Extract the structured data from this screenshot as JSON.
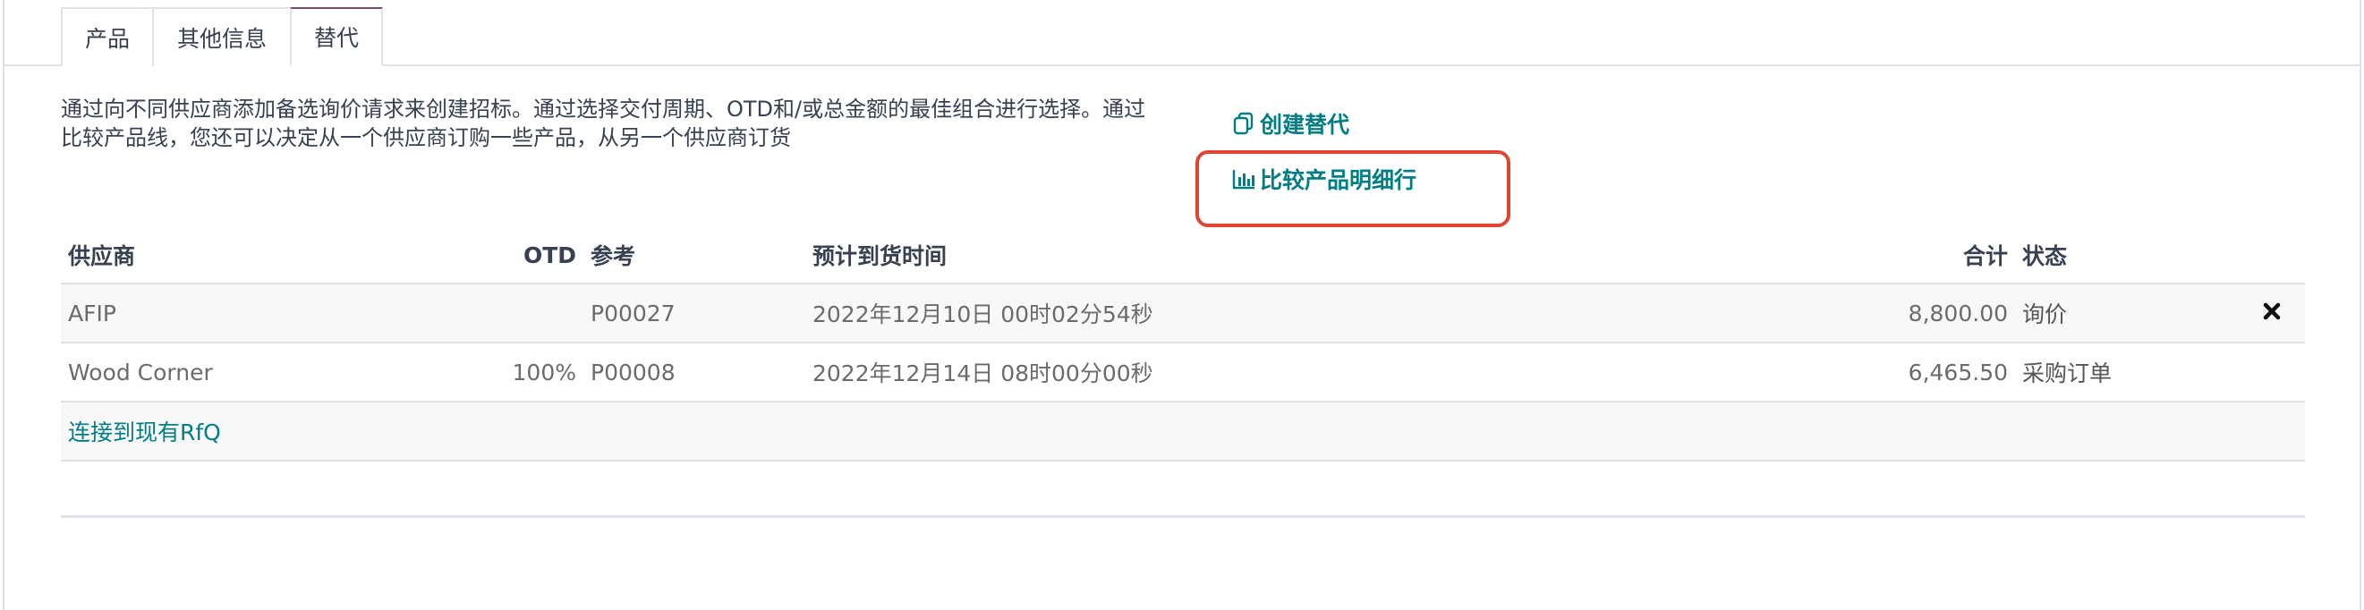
{
  "tabs": [
    {
      "label": "产品"
    },
    {
      "label": "其他信息"
    },
    {
      "label": "替代"
    }
  ],
  "description": "通过向不同供应商添加备选询价请求来创建招标。通过选择交付周期、OTD和/或总金额的最佳组合进行选择。通过比较产品线，您还可以决定从一个供应商订购一些产品，从另一个供应商订货",
  "actions": {
    "create_alternative": "创建替代",
    "compare_lines": "比较产品明细行"
  },
  "table": {
    "headers": {
      "vendor": "供应商",
      "otd": "OTD",
      "reference": "参考",
      "expected_arrival": "预计到货时间",
      "total": "合计",
      "status": "状态"
    },
    "rows": [
      {
        "vendor": "AFIP",
        "otd": "",
        "reference": "P00027",
        "expected_arrival": "2022年12月10日 00时02分54秒",
        "total": "8,800.00",
        "status": "询价"
      },
      {
        "vendor": "Wood Corner",
        "otd": "100%",
        "reference": "P00008",
        "expected_arrival": "2022年12月14日 08时00分00秒",
        "total": "6,465.50",
        "status": "采购订单"
      }
    ],
    "link_existing": "连接到现有RfQ"
  },
  "colors": {
    "accent": "#017e84",
    "highlight": "#e0462f",
    "tab_active": "#714b67"
  }
}
